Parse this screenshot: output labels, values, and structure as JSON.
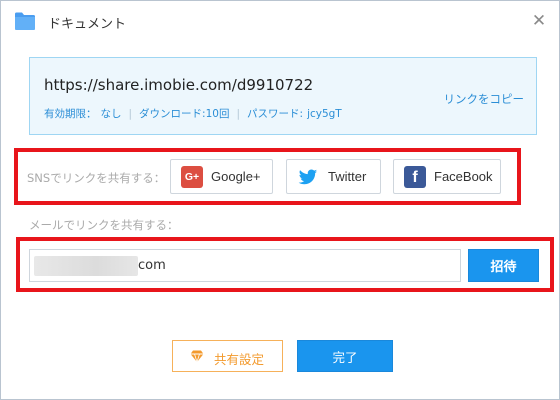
{
  "title": "ドキュメント",
  "link": {
    "url": "https://share.imobie.com/d9910722",
    "expiry_label": "有効期限：",
    "expiry_value": "なし",
    "download_label": "ダウンロード:",
    "download_value": "10回",
    "password_label": "パスワード:",
    "password_value": "jcy5gT",
    "copy_label": "リンクをコピー"
  },
  "sns": {
    "label": "SNSでリンクを共有する：",
    "google": {
      "icon_text": "G+",
      "label": "Google+"
    },
    "twitter": {
      "label": "Twitter"
    },
    "facebook": {
      "icon_text": "f",
      "label": "FaceBook"
    }
  },
  "mail": {
    "label": "メールでリンクを共有する：",
    "input_value": "com",
    "invite_label": "招待"
  },
  "footer": {
    "share_settings_label": "共有設定",
    "done_label": "完了"
  },
  "colors": {
    "accent": "#1a95ee",
    "highlight": "#e8151b",
    "link": "#2b8ed6",
    "secondary": "#f39a2d",
    "google": "#dc4e41",
    "facebook": "#3b5998",
    "twitter": "#1da1f2",
    "folder": "#4a9df0"
  }
}
